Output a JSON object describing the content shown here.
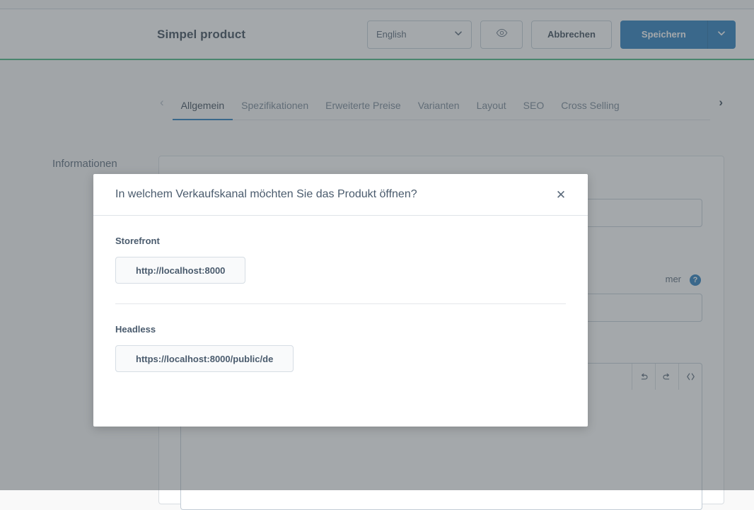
{
  "smart_bar": {
    "title": "Simpel product",
    "language_value": "English",
    "language_caret": "chevron-down",
    "preview_icon": "eye",
    "cancel_label": "Abbrechen",
    "save_label": "Speichern",
    "save_caret": "chevron-down",
    "accent_green": "#37b178",
    "primary_blue": "#1471b9"
  },
  "tabs": {
    "prev_arrow": "‹",
    "next_arrow": "›",
    "items": [
      {
        "label": "Allgemein",
        "active": true
      },
      {
        "label": "Spezifikationen",
        "active": false
      },
      {
        "label": "Erweiterte Preise",
        "active": false
      },
      {
        "label": "Varianten",
        "active": false
      },
      {
        "label": "Layout",
        "active": false
      },
      {
        "label": "SEO",
        "active": false
      },
      {
        "label": "Cross Selling",
        "active": false
      }
    ]
  },
  "content": {
    "info_label": "Informationen",
    "field_label_partial": "mer",
    "help_badge": "?",
    "toolbar_icons": [
      "undo-icon",
      "redo-icon",
      "code-icon"
    ],
    "toolbar_glyphs": [
      "↩",
      "↪",
      "‹›"
    ]
  },
  "modal": {
    "title": "In welchem Verkaufskanal möchten Sie das Produkt öffnen?",
    "close_glyph": "✕",
    "sections": [
      {
        "label": "Storefront",
        "url": "http://localhost:8000"
      },
      {
        "label": "Headless",
        "url": "https://localhost:8000/public/de"
      }
    ]
  }
}
